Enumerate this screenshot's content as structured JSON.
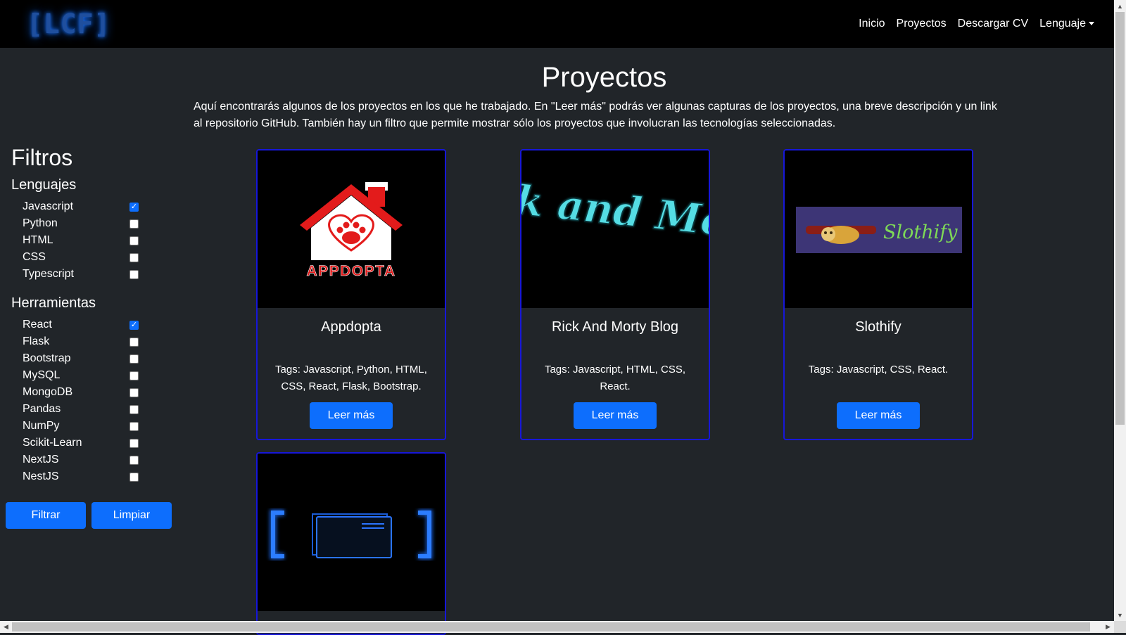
{
  "navbar": {
    "brand": "[LCF]",
    "links": [
      {
        "label": "Inicio"
      },
      {
        "label": "Proyectos"
      },
      {
        "label": "Descargar CV"
      },
      {
        "label": "Lenguaje"
      }
    ]
  },
  "header": {
    "title": "Proyectos",
    "intro": "Aquí encontrarás algunos de los proyectos en los que he trabajado. En \"Leer más\" podrás ver algunas capturas de los proyectos, una breve descripción y un link al repositorio GitHub. También hay un filtro que permite mostrar sólo los proyectos que involucran las tecnologías seleccionadas."
  },
  "filters": {
    "title": "Filtros",
    "languages": {
      "title": "Lenguajes",
      "items": [
        {
          "label": "Javascript",
          "checked": true
        },
        {
          "label": "Python",
          "checked": false
        },
        {
          "label": "HTML",
          "checked": false
        },
        {
          "label": "CSS",
          "checked": false
        },
        {
          "label": "Typescript",
          "checked": false
        }
      ]
    },
    "tools": {
      "title": "Herramientas",
      "items": [
        {
          "label": "React",
          "checked": true
        },
        {
          "label": "Flask",
          "checked": false
        },
        {
          "label": "Bootstrap",
          "checked": false
        },
        {
          "label": "MySQL",
          "checked": false
        },
        {
          "label": "MongoDB",
          "checked": false
        },
        {
          "label": "Pandas",
          "checked": false
        },
        {
          "label": "NumPy",
          "checked": false
        },
        {
          "label": "Scikit-Learn",
          "checked": false
        },
        {
          "label": "NextJS",
          "checked": false
        },
        {
          "label": "NestJS",
          "checked": false
        }
      ]
    },
    "filter_button": "Filtrar",
    "clear_button": "Limpiar"
  },
  "projects": [
    {
      "title": "Appdopta",
      "logo_text": "APPDOPTA",
      "tags": "Tags: Javascript, Python, HTML, CSS, React, Flask, Bootstrap.",
      "button": "Leer más"
    },
    {
      "title": "Rick And Morty Blog",
      "logo_text": "Rick and Morty",
      "tags": "Tags: Javascript, HTML, CSS, React.",
      "button": "Leer más"
    },
    {
      "title": "Slothify",
      "logo_text": "Slothify",
      "tags": "Tags: Javascript, CSS, React.",
      "button": "Leer más"
    }
  ],
  "colors": {
    "accent": "#0d6efd",
    "card_border": "#1717d8",
    "background": "#212529",
    "navbar": "#000000"
  }
}
